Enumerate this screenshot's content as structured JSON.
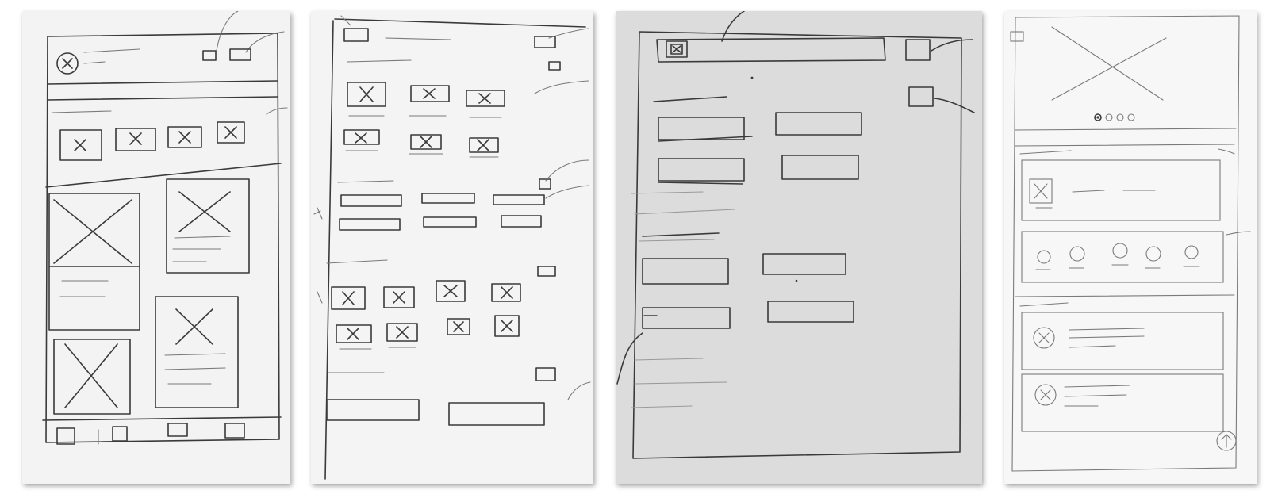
{
  "colors": {
    "page_background": "#ffffff",
    "paper_1": "#f3f3f3",
    "paper_2": "#f4f4f4",
    "paper_3": "#dcdcdc",
    "paper_4": "#f7f7f7",
    "pencil": "#3a3a3a"
  },
  "sketches": [
    {
      "subject": "home-screen-wireframe",
      "elements": [
        "header-with-avatar-icon",
        "two-header-action-boxes",
        "category-image-row",
        "card-grid-with-image-placeholders",
        "bottom-tab-bar"
      ]
    },
    {
      "subject": "grid-listing-wireframe",
      "elements": [
        "header-box",
        "image-thumbnail-grid",
        "button-rows",
        "icon-grid",
        "two-wide-buttons"
      ]
    },
    {
      "subject": "form-screen-wireframe",
      "elements": [
        "search-bar-with-icon",
        "side-box-buttons",
        "field-pairs"
      ]
    },
    {
      "subject": "detail-screen-wireframe",
      "elements": [
        "hero-image-placeholder",
        "pagination-dots",
        "list-card",
        "icon-row",
        "avatar-list-items",
        "scroll-up-button"
      ]
    }
  ]
}
